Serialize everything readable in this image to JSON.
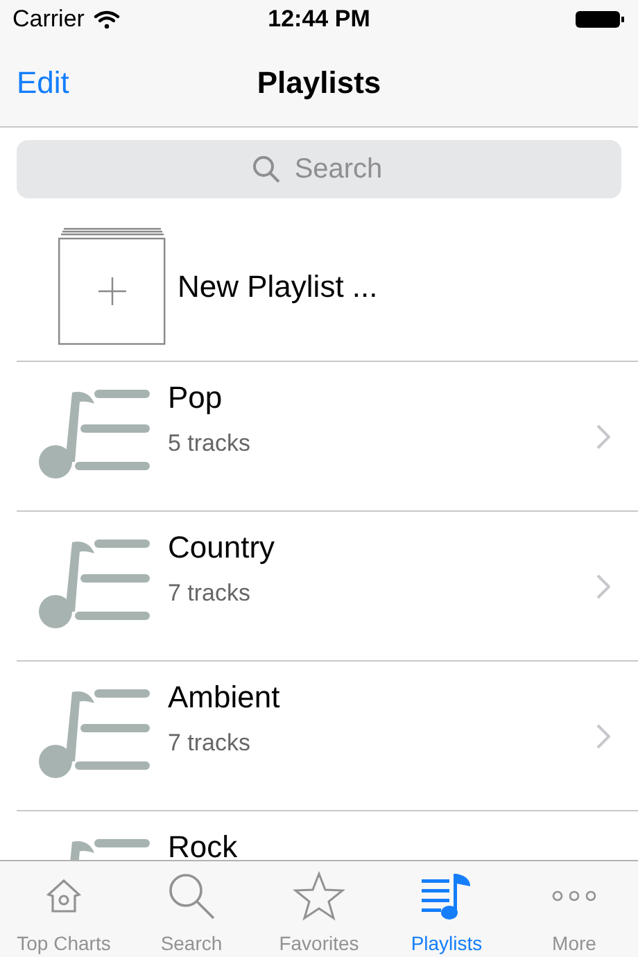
{
  "status_bar": {
    "carrier": "Carrier",
    "time": "12:44 PM"
  },
  "nav_bar": {
    "left_button": "Edit",
    "title": "Playlists"
  },
  "search": {
    "placeholder": "Search"
  },
  "new_playlist": {
    "label": "New Playlist ..."
  },
  "playlists": [
    {
      "name": "Pop",
      "subtitle": "5 tracks"
    },
    {
      "name": "Country",
      "subtitle": "7 tracks"
    },
    {
      "name": "Ambient",
      "subtitle": "7 tracks"
    },
    {
      "name": "Rock"
    }
  ],
  "tab_bar": [
    {
      "kind": "home",
      "label": "Top Charts",
      "selected": false
    },
    {
      "kind": "search",
      "label": "Search",
      "selected": false
    },
    {
      "kind": "star",
      "label": "Favorites",
      "selected": false
    },
    {
      "kind": "playlist",
      "label": "Playlists",
      "selected": true
    },
    {
      "kind": "more",
      "label": "More",
      "selected": false
    }
  ]
}
